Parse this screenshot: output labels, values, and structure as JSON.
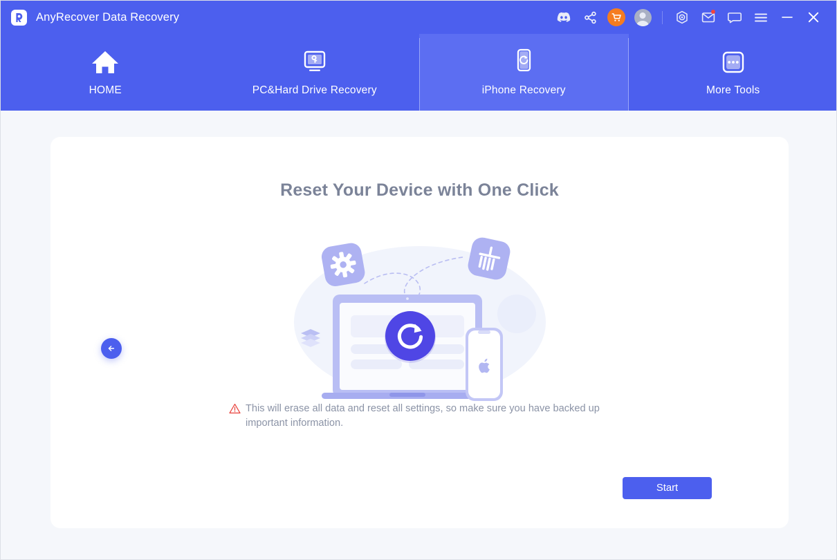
{
  "window": {
    "brand_initial": "R",
    "title": "AnyRecover Data Recovery",
    "logo_name": "anyrecover-logo"
  },
  "titlebar": {
    "icons": [
      {
        "name": "discord-icon",
        "label": "Discord"
      },
      {
        "name": "share-icon",
        "label": "Share"
      },
      {
        "name": "cart-icon",
        "label": "Buy Now"
      },
      {
        "name": "account-icon",
        "label": "Account"
      },
      {
        "name": "target-icon",
        "label": "Register"
      },
      {
        "name": "mail-icon",
        "label": "Messages"
      },
      {
        "name": "chat-icon",
        "label": "Feedback"
      },
      {
        "name": "menu-icon",
        "label": "Menu"
      },
      {
        "name": "minimize-icon",
        "label": "Minimize"
      },
      {
        "name": "close-icon",
        "label": "Close"
      }
    ],
    "accent_orange": "#f57c20",
    "notification_dot_color": "#f2453d"
  },
  "nav": {
    "tabs": [
      {
        "label": "HOME",
        "icon": "home-icon",
        "active": false
      },
      {
        "label": "PC&Hard Drive Recovery",
        "icon": "monitor-key-icon",
        "active": false
      },
      {
        "label": "iPhone Recovery",
        "icon": "phone-refresh-icon",
        "active": true
      },
      {
        "label": "More Tools",
        "icon": "more-dots-icon",
        "active": false
      }
    ],
    "background": "#4c5fee",
    "active_background": "#5c6ef2"
  },
  "main": {
    "heading": "Reset Your Device with One Click",
    "illustration_name": "device-reset-illustration",
    "warning": {
      "icon": "warning-triangle-icon",
      "text": "This will erase all data and reset all settings, so make sure you have backed up important information."
    },
    "back_button": {
      "label": "Back",
      "icon": "arrow-left-icon"
    },
    "start_button": {
      "label": "Start"
    }
  },
  "colors": {
    "primary": "#4c5fee",
    "page_background": "#f5f7fb",
    "card_background": "#ffffff",
    "heading_text": "#7b8398",
    "body_text": "#8b93a6",
    "warning_red": "#e8403a",
    "illustration_purple": "#a5a8f0",
    "illustration_deep": "#4f46e5"
  }
}
